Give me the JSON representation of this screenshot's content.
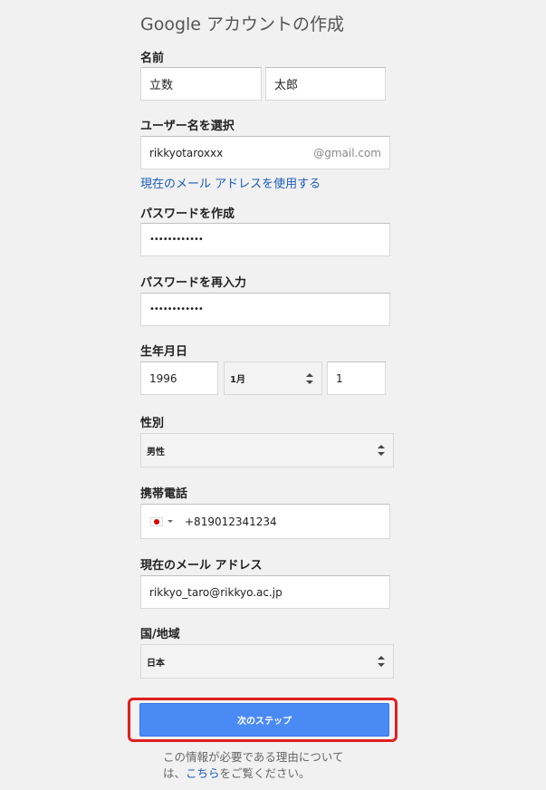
{
  "title": "Google アカウントの作成",
  "name": {
    "label": "名前",
    "last": "立数",
    "first": "太郎"
  },
  "username": {
    "label": "ユーザー名を選択",
    "value": "rikkyotaroxxx",
    "suffix": "@gmail.com",
    "use_current_link": "現在のメール アドレスを使用する"
  },
  "password": {
    "label": "パスワードを作成",
    "value": "••••••••••••"
  },
  "password_confirm": {
    "label": "パスワードを再入力",
    "value": "••••••••••••"
  },
  "birthday": {
    "label": "生年月日",
    "year": "1996",
    "month": "1月",
    "day": "1"
  },
  "gender": {
    "label": "性別",
    "value": "男性"
  },
  "phone": {
    "label": "携帯電話",
    "value": "+819012341234",
    "flag_icon": "japan-flag-icon"
  },
  "current_email": {
    "label": "現在のメール アドレス",
    "value": "rikkyo_taro@rikkyo.ac.jp"
  },
  "country": {
    "label": "国/地域",
    "value": "日本"
  },
  "next_button": {
    "label": "次のステップ"
  },
  "footnote": {
    "line1": "この情報が必要である理由について",
    "prefix": "は、",
    "link": "こちら",
    "suffix": "をご覧ください。"
  },
  "colors": {
    "background": "#f1f1f1",
    "primary_button": "#4a8af4",
    "link": "#1a5bb8",
    "highlight": "#e02020"
  }
}
